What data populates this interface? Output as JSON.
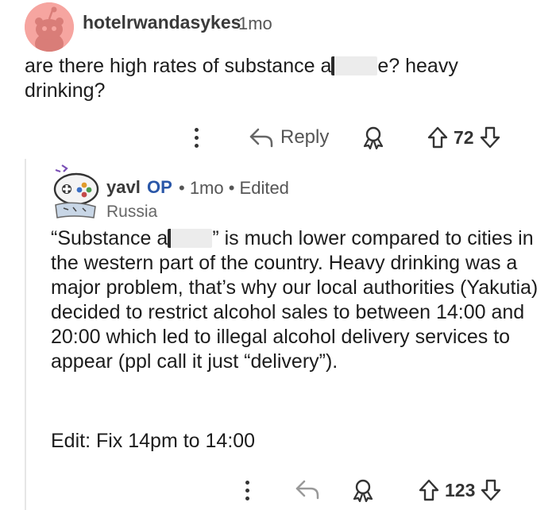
{
  "top_comment": {
    "username": "hotelrwandasykes",
    "time": "1mo",
    "text_before": "are there high rates of substance a",
    "text_after": "e? heavy drinking?",
    "actions": {
      "reply_label": "Reply",
      "upvotes": "72"
    }
  },
  "reply_comment": {
    "username": "yavl",
    "op_badge": "OP",
    "meta": "• 1mo • Edited",
    "flair": "Russia",
    "text_before": "“Substance a",
    "text_after": "” is much lower compared to cities in the western part of the country. Heavy drinking was a major problem, that’s why our local authorities (Yakutia) decided to restrict alcohol sales to between 14:00 and 20:00 which led to illegal alcohol delivery services to appear (ppl call it just “delivery”).",
    "edit_note": "Edit: Fix 14pm to 14:00",
    "actions": {
      "upvotes": "123"
    }
  },
  "icons": [
    "more-options-icon",
    "reply-arrow-icon",
    "award-icon",
    "upvote-arrow-icon",
    "downvote-arrow-icon",
    "snoo-avatar-icon"
  ]
}
